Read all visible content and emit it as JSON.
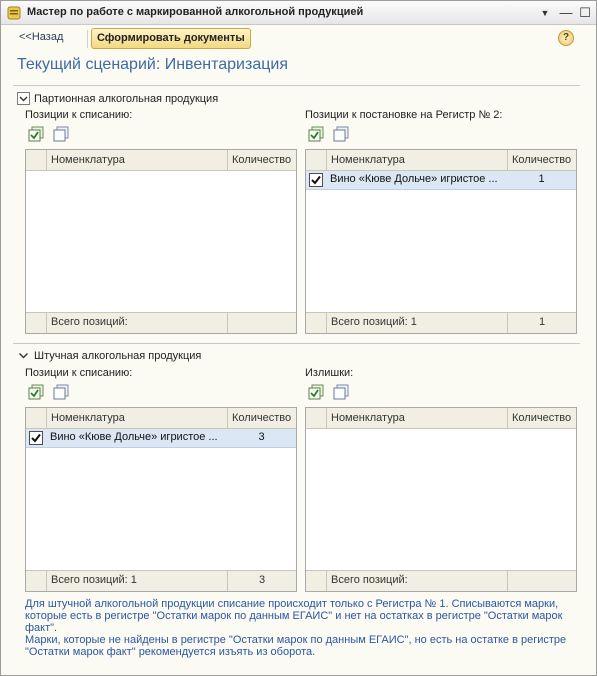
{
  "window": {
    "title": "Мастер по работе с маркированной алкогольной продукцией",
    "icon": "app-icon",
    "controls": [
      "menu-icon",
      "minimize-icon",
      "maximize-icon",
      "close-icon"
    ]
  },
  "toolbar": {
    "back_label": "<<Назад",
    "generate_label": "Сформировать документы",
    "help_label": "?"
  },
  "scenario_title": "Текущий сценарий: Инвентаризация",
  "batch": {
    "group_label": "Партионная алкогольная продукция",
    "left": {
      "label": "Позиции к списанию:",
      "columns": [
        "Номенклатура",
        "Количество"
      ],
      "rows": [],
      "footer_label": "Всего позиций:",
      "footer_qty": ""
    },
    "right": {
      "label": "Позиции к постановке на Регистр № 2:",
      "columns": [
        "Номенклатура",
        "Количество"
      ],
      "rows": [
        {
          "checked": true,
          "name": "Вино «Кюве Дольче» игристое ...",
          "qty": "1"
        }
      ],
      "footer_label": "Всего позиций: 1",
      "footer_qty": "1"
    }
  },
  "piece": {
    "group_label": "Штучная алкогольная продукция",
    "left": {
      "label": "Позиции к списанию:",
      "columns": [
        "Номенклатура",
        "Количество"
      ],
      "rows": [
        {
          "checked": true,
          "name": "Вино «Кюве Дольче» игристое ...",
          "qty": "3"
        }
      ],
      "footer_label": "Всего позиций: 1",
      "footer_qty": "3"
    },
    "right": {
      "label": "Излишки:",
      "columns": [
        "Номенклатура",
        "Количество"
      ],
      "rows": [],
      "footer_label": "Всего позиций:",
      "footer_qty": ""
    }
  },
  "info_text": {
    "line1": "Для штучной алкогольной продукции списание происходит только с Регистра № 1. Списываются марки, которые есть в регистре \"Остатки марок по данным ЕГАИС\" и нет на остатках в регистре \"Остатки марок факт\".",
    "line2": "Марки, которые не найдены в регистре \"Остатки марок по данным ЕГАИС\", но есть на остатке в регистре \"Остатки марок факт\" рекомендуется изъять из оборота."
  },
  "colors": {
    "accent_title": "#3d6ba7",
    "info_text": "#2c57a3",
    "primary_button": "#f2d980",
    "selected_row": "#dce7f6"
  }
}
